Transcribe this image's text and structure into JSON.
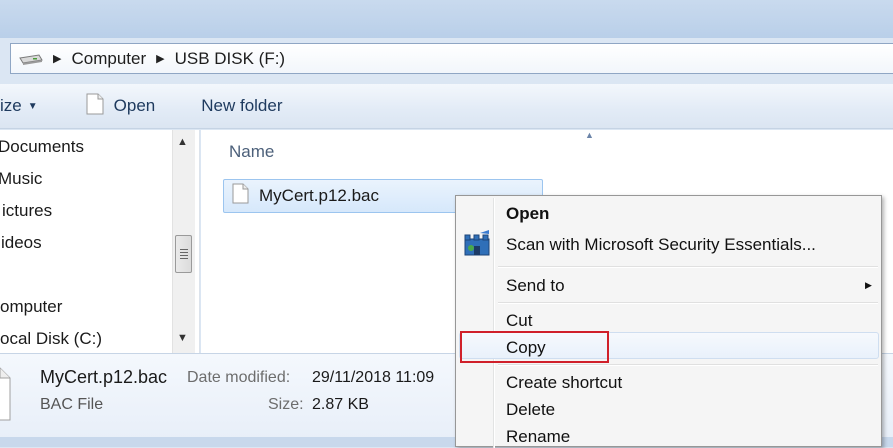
{
  "address": {
    "crumbs": [
      "Computer",
      "USB DISK (F:)"
    ]
  },
  "toolbar": {
    "organize_label": "ize",
    "open_label": "Open",
    "new_folder_label": "New folder"
  },
  "nav": {
    "items": [
      "Documents",
      "Music",
      "Pictures",
      "Videos",
      "Computer",
      "Local Disk (C:)"
    ],
    "visible_text": [
      "Documents",
      "Music",
      "ictures",
      "ideos",
      "omputer",
      "ocal Disk (C:)"
    ]
  },
  "content": {
    "column_name": "Name",
    "file_name": "MyCert.p12.bac"
  },
  "details": {
    "file_name": "MyCert.p12.bac",
    "file_type": "BAC File",
    "date_label": "Date modified:",
    "date_value": "29/11/2018 11:09",
    "size_label": "Size:",
    "size_value": "2.87 KB"
  },
  "context_menu": {
    "open": "Open",
    "scan": "Scan with Microsoft Security Essentials...",
    "send_to": "Send to",
    "cut": "Cut",
    "copy": "Copy",
    "create_shortcut": "Create shortcut",
    "delete": "Delete",
    "rename": "Rename"
  },
  "colors": {
    "highlight_box": "#d0202a",
    "selection": "#d6e8fb"
  }
}
